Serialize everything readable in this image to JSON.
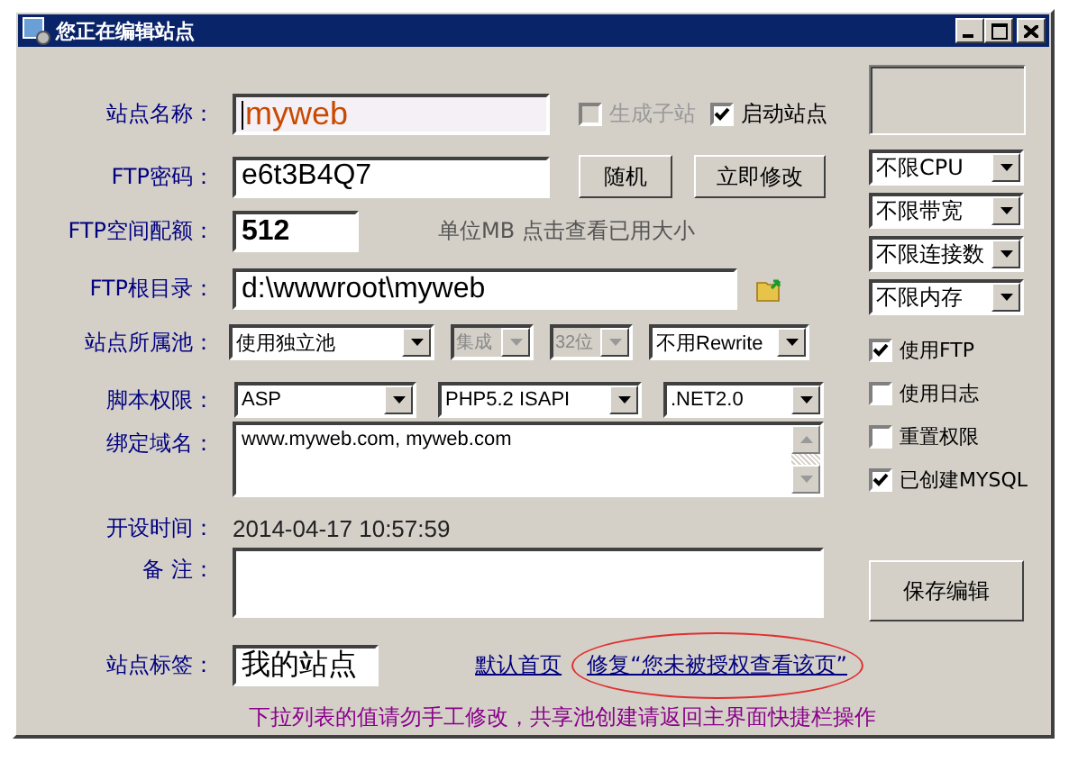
{
  "window": {
    "title": "您正在编辑站点"
  },
  "site_name": {
    "label": "站点名称：",
    "value": "myweb"
  },
  "site_checks": [
    {
      "label": "生成子站",
      "checked": false,
      "disabled": true
    },
    {
      "label": "启动站点",
      "checked": true,
      "disabled": false
    }
  ],
  "ftp_password": {
    "label": "FTP密码：",
    "value": "e6t3B4Q7"
  },
  "password_buttons": [
    "随机",
    "立即修改"
  ],
  "ftp_quota": {
    "label": "FTP空间配额：",
    "value": "512",
    "hint": "单位MB 点击查看已用大小"
  },
  "ftp_root": {
    "label": "FTP根目录：",
    "value": "d:\\wwwroot\\myweb"
  },
  "pool": {
    "label": "站点所属池：",
    "selects": [
      {
        "value": "使用独立池",
        "disabled": false
      },
      {
        "value": "集成",
        "disabled": true
      },
      {
        "value": "32位",
        "disabled": true
      },
      {
        "value": "不用Rewrite",
        "disabled": false
      }
    ]
  },
  "script": {
    "label": "脚本权限：",
    "selects": [
      {
        "value": "ASP",
        "disabled": false
      },
      {
        "value": "PHP5.2 ISAPI",
        "disabled": false
      },
      {
        "value": ".NET2.0",
        "disabled": false
      }
    ]
  },
  "domains": {
    "label": "绑定域名：",
    "value": "www.myweb.com, myweb.com"
  },
  "created": {
    "label": "开设时间：",
    "value": "2014-04-17 10:57:59"
  },
  "remark": {
    "label": "备 注："
  },
  "tag": {
    "label": "站点标签：",
    "value": "我的站点"
  },
  "links": [
    {
      "label": "默认首页",
      "circled": false
    },
    {
      "label": "修复“您未被授权查看该页”",
      "circled": true
    }
  ],
  "limits": [
    "不限CPU",
    "不限带宽",
    "不限连接数",
    "不限内存"
  ],
  "options": [
    {
      "label": "使用FTP",
      "checked": true
    },
    {
      "label": "使用日志",
      "checked": false
    },
    {
      "label": "重置权限",
      "checked": false
    },
    {
      "label": "已创建MYSQL",
      "checked": true
    }
  ],
  "save_button": "保存编辑",
  "note": "下拉列表的值请勿手工修改，共享池创建请返回主界面快捷栏操作"
}
